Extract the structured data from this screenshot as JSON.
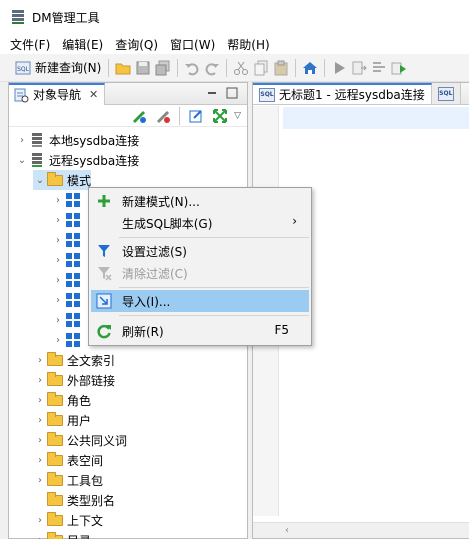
{
  "window": {
    "title": "DM管理工具"
  },
  "menubar": [
    {
      "label": "文件(F)"
    },
    {
      "label": "编辑(E)"
    },
    {
      "label": "查询(Q)"
    },
    {
      "label": "窗口(W)"
    },
    {
      "label": "帮助(H)"
    }
  ],
  "toolbar": {
    "new_query_label": "新建查询(N)"
  },
  "navigator": {
    "tab_label": "对象导航",
    "nodes": [
      {
        "label": "本地sysdba连接",
        "level": 1,
        "arrow": "›",
        "icon": "database-icon"
      },
      {
        "label": "远程sysdba连接",
        "level": 1,
        "arrow": "⌄",
        "icon": "database-icon"
      },
      {
        "label": "模式",
        "level": 2,
        "arrow": "⌄",
        "icon": "folder-open-icon"
      },
      {
        "label": "",
        "level": 3,
        "arrow": "›",
        "icon": "schema-icon"
      },
      {
        "label": "",
        "level": 3,
        "arrow": "›",
        "icon": "schema-icon"
      },
      {
        "label": "",
        "level": 3,
        "arrow": "›",
        "icon": "schema-icon"
      },
      {
        "label": "",
        "level": 3,
        "arrow": "›",
        "icon": "schema-icon"
      },
      {
        "label": "",
        "level": 3,
        "arrow": "›",
        "icon": "schema-icon"
      },
      {
        "label": "",
        "level": 3,
        "arrow": "›",
        "icon": "schema-icon"
      },
      {
        "label": "",
        "level": 3,
        "arrow": "›",
        "icon": "schema-icon"
      },
      {
        "label": "",
        "level": 3,
        "arrow": "›",
        "icon": "schema-icon"
      },
      {
        "label": "全文索引",
        "level": 2,
        "arrow": "›",
        "icon": "folder-icon"
      },
      {
        "label": "外部链接",
        "level": 2,
        "arrow": "›",
        "icon": "folder-icon"
      },
      {
        "label": "角色",
        "level": 2,
        "arrow": "›",
        "icon": "folder-icon"
      },
      {
        "label": "用户",
        "level": 2,
        "arrow": "›",
        "icon": "folder-icon"
      },
      {
        "label": "公共同义词",
        "level": 2,
        "arrow": "›",
        "icon": "folder-icon"
      },
      {
        "label": "表空间",
        "level": 2,
        "arrow": "›",
        "icon": "folder-icon"
      },
      {
        "label": "工具包",
        "level": 2,
        "arrow": "›",
        "icon": "folder-icon"
      },
      {
        "label": "类型别名",
        "level": 2,
        "arrow": "",
        "icon": "folder-icon"
      },
      {
        "label": "上下文",
        "level": 2,
        "arrow": "›",
        "icon": "folder-icon"
      },
      {
        "label": "目录",
        "level": 2,
        "arrow": "›",
        "icon": "folder-icon"
      }
    ]
  },
  "editor": {
    "tab_label": "无标题1 - 远程sysdba连接"
  },
  "context_menu": {
    "items": [
      {
        "label": "新建模式(N)...",
        "icon": "plus-icon",
        "shortcut": "",
        "submenu": false,
        "disabled": false
      },
      {
        "label": "生成SQL脚本(G)",
        "icon": "",
        "shortcut": "",
        "submenu": true,
        "disabled": false
      },
      {
        "label": "设置过滤(S)",
        "icon": "filter-icon",
        "shortcut": "",
        "submenu": false,
        "disabled": false
      },
      {
        "label": "清除过滤(C)",
        "icon": "clear-filter-icon",
        "shortcut": "",
        "submenu": false,
        "disabled": true
      },
      {
        "label": "导入(I)...",
        "icon": "import-icon",
        "shortcut": "",
        "submenu": false,
        "disabled": false
      },
      {
        "label": "刷新(R)",
        "icon": "refresh-icon",
        "shortcut": "F5",
        "submenu": false,
        "disabled": false
      }
    ],
    "submenu_glyph": "›"
  },
  "colors": {
    "accent": "#3c7fd6",
    "hover": "#9ccbf2",
    "selection": "#cce4f7"
  }
}
